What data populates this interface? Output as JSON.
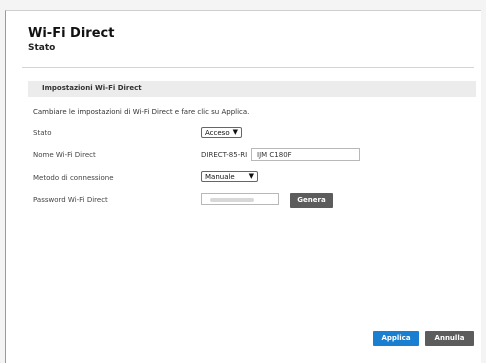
{
  "header": {
    "title": "Wi-Fi Direct",
    "subtitle": "Stato"
  },
  "section": {
    "title": "Impostazioni Wi-Fi Direct",
    "instructions": "Cambiare le impostazioni di Wi-Fi Direct e fare clic su Applica."
  },
  "fields": {
    "status_label": "Stato",
    "status_value": "Acceso",
    "name_label": "Nome Wi-Fi Direct",
    "name_prefix": "DIRECT-85-RI",
    "name_value": "IJM C180F",
    "method_label": "Metodo di connessione",
    "method_value": "Manuale",
    "password_label": "Password Wi-Fi Direct",
    "password_value": ""
  },
  "buttons": {
    "generate": "Genera",
    "apply": "Applica",
    "cancel": "Annulla"
  },
  "colors": {
    "apply_button": "#1b7fd1",
    "secondary_button": "#5c5c5c",
    "section_bg": "#ececec"
  }
}
